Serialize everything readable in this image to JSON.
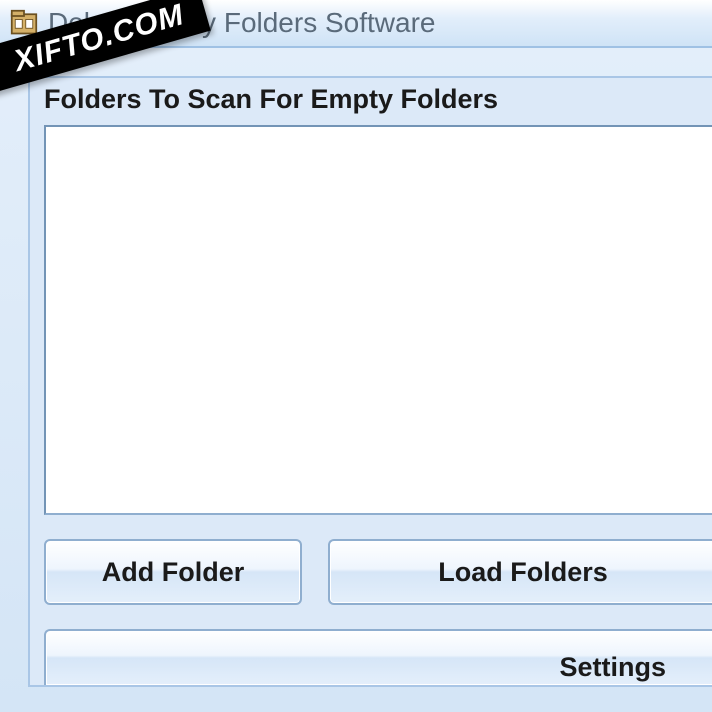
{
  "window": {
    "title_prefix": "Del",
    "title_suffix": "Empty Folders Software"
  },
  "group": {
    "label": "Folders To Scan For Empty Folders"
  },
  "buttons": {
    "add_folder": "Add Folder",
    "load_folders": "Load Folders",
    "settings": "Settings"
  },
  "watermark": "XIFTO.COM"
}
